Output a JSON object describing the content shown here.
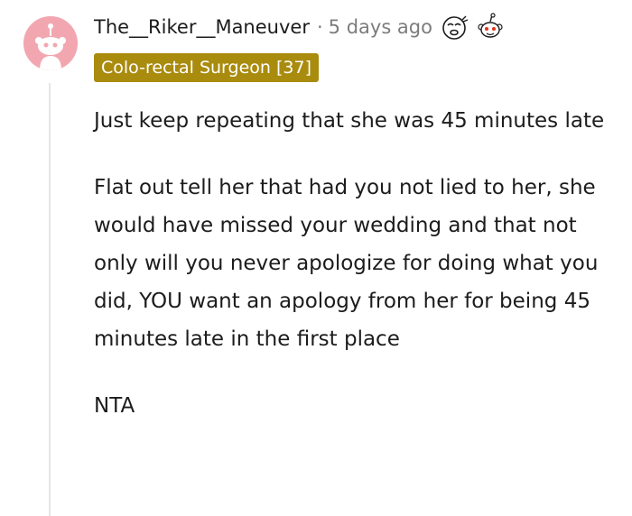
{
  "comment": {
    "username": "The__Riker__Maneuver",
    "separator": "·",
    "time_ago": "5 days ago",
    "flair": "Colo-rectal Surgeon [37]",
    "paragraphs": [
      "Just keep repeating that she was 45 minutes late",
      "Flat out tell her that had you not lied to her, she would have missed your wedding and that not only will you never apologize for doing what you did, YOU want an apology from her for being 45 minutes late in the first place",
      "NTA"
    ],
    "avatar_icon": "snoo-avatar-icon",
    "awards": [
      "tired-face-award-icon",
      "wholesome-snoo-award-icon"
    ]
  },
  "colors": {
    "avatar_bg": "#f2a7b0",
    "flair_bg": "#a98b0e",
    "text": "#1c1c1c",
    "meta": "#7c7c7c"
  }
}
